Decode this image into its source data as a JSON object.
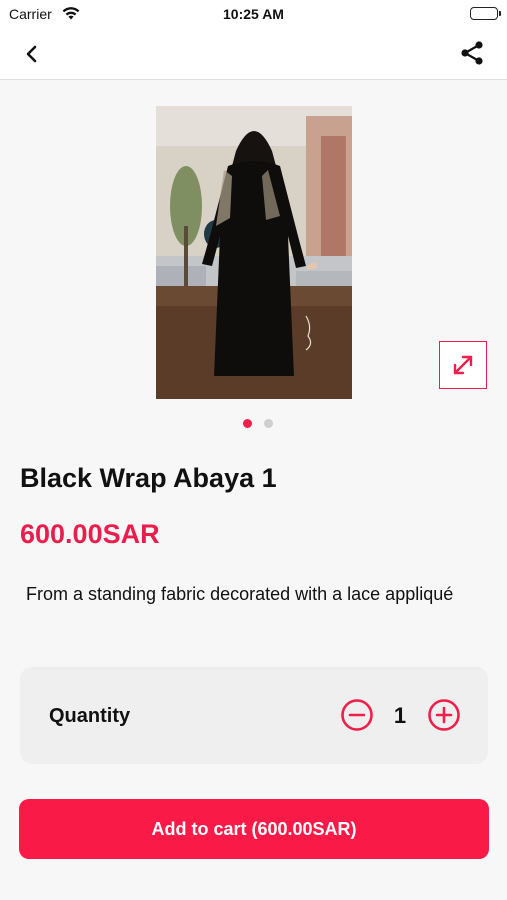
{
  "status_bar": {
    "carrier": "Carrier",
    "time": "10:25 AM"
  },
  "nav": {
    "back_icon": "chevron-left-icon",
    "share_icon": "share-icon"
  },
  "gallery": {
    "image_alt": "Black wrap abaya shown from the back",
    "page_count": 2,
    "active_page": 1,
    "expand_icon": "expand-arrows-icon"
  },
  "product": {
    "title": "Black Wrap Abaya 1",
    "price": "600.00SAR",
    "description": "From a standing fabric decorated with a lace appliqué"
  },
  "quantity": {
    "label": "Quantity",
    "value": "1"
  },
  "cart_button": {
    "label": "Add to cart (600.00SAR)"
  },
  "colors": {
    "accent": "#f01e4a",
    "price": "#e91e4d",
    "button_bg": "#fa1a48"
  }
}
